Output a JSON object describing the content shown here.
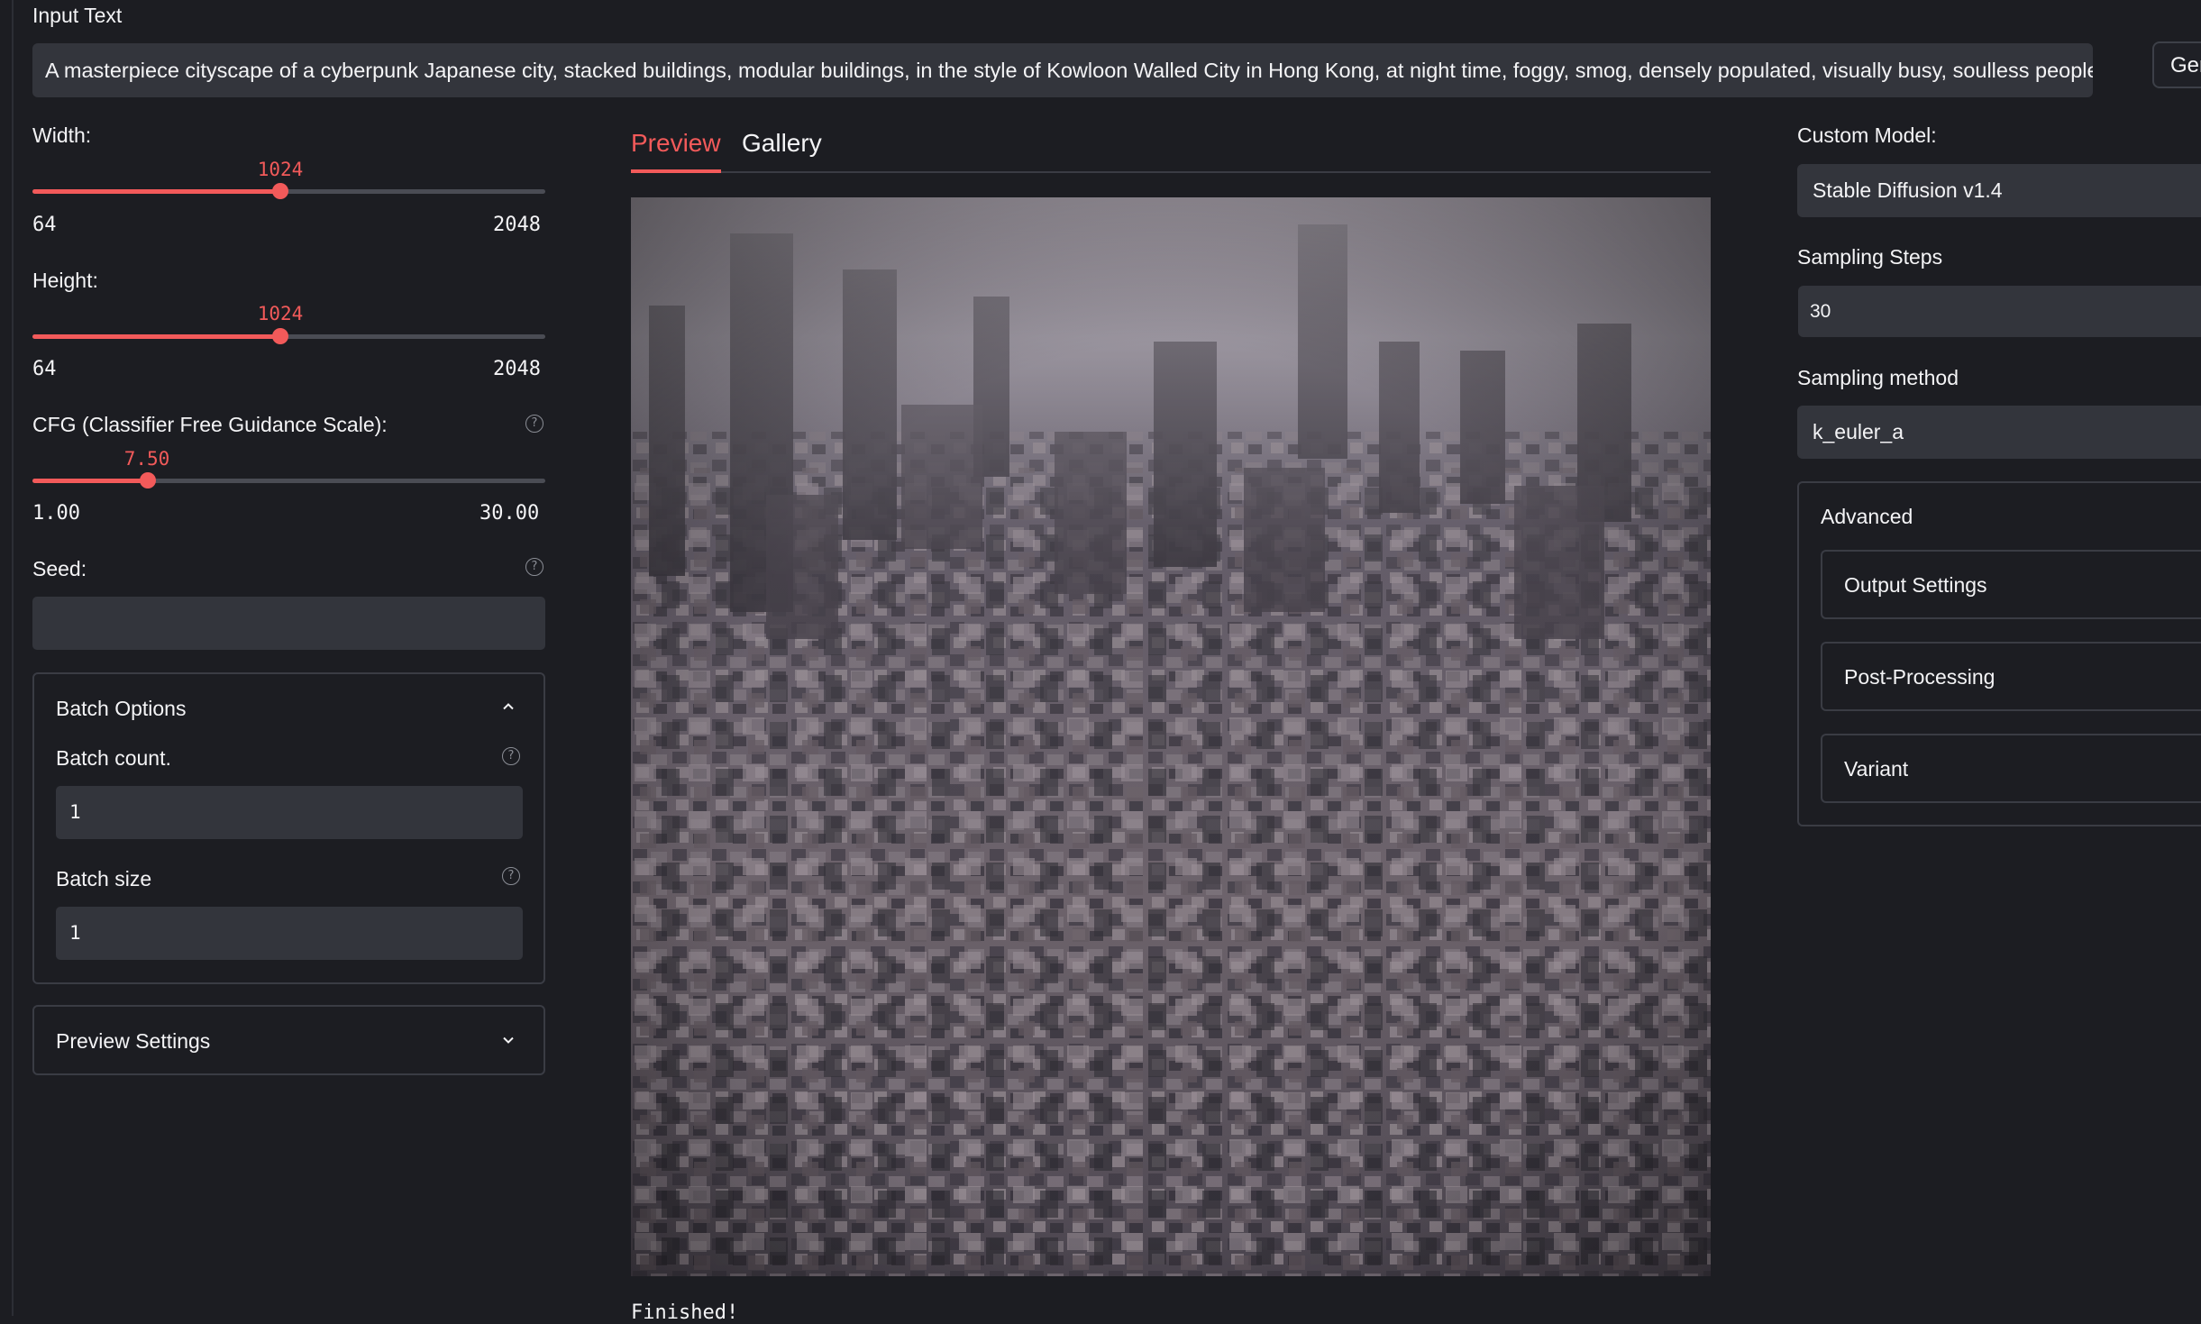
{
  "prompt": {
    "label": "Input Text",
    "value": "A masterpiece cityscape of a cyberpunk Japanese city, stacked buildings, modular buildings, in the style of Kowloon Walled City in Hong Kong, at night time, foggy, smog, densely populated, visually busy, soulless people, depres"
  },
  "generate_button": {
    "label": "Ger"
  },
  "width": {
    "label": "Width:",
    "value": "1024",
    "min": "64",
    "max": "2048",
    "fraction": 0.485
  },
  "height": {
    "label": "Height:",
    "value": "1024",
    "min": "64",
    "max": "2048",
    "fraction": 0.485
  },
  "cfg": {
    "label": "CFG (Classifier Free Guidance Scale):",
    "value": "7.50",
    "min": "1.00",
    "max": "30.00",
    "fraction": 0.224
  },
  "seed": {
    "label": "Seed:",
    "value": ""
  },
  "batch_options": {
    "title": "Batch Options",
    "count_label": "Batch count.",
    "count_value": "1",
    "size_label": "Batch size",
    "size_value": "1"
  },
  "preview_settings": {
    "title": "Preview Settings"
  },
  "tabs": [
    {
      "label": "Preview",
      "active": true
    },
    {
      "label": "Gallery",
      "active": false
    }
  ],
  "status": {
    "text": "Finished!"
  },
  "right": {
    "model_label": "Custom Model:",
    "model_value": "Stable Diffusion v1.4",
    "steps_label": "Sampling Steps",
    "steps_value": "30",
    "method_label": "Sampling method",
    "method_value": "k_euler_a",
    "advanced": {
      "title": "Advanced",
      "items": [
        "Output Settings",
        "Post-Processing",
        "Variant"
      ]
    }
  },
  "icons": {
    "help": "question-circle-icon",
    "collapse": "chevron-up-icon",
    "expand": "chevron-down-icon"
  },
  "colors": {
    "accent": "#f25a5a",
    "background": "#1c1d22",
    "field": "#33353c"
  }
}
